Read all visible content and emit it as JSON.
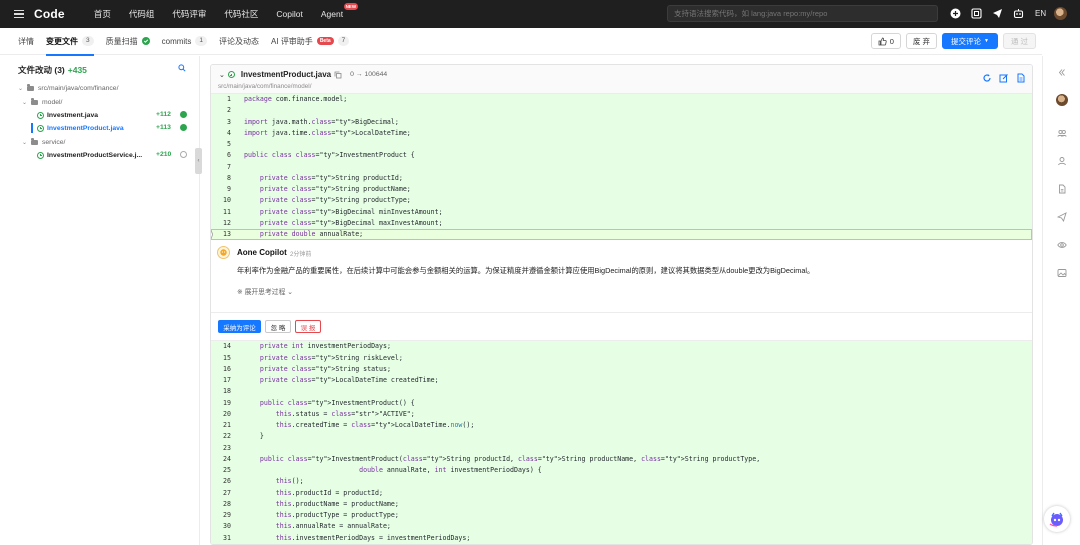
{
  "navbar": {
    "brand": "Code",
    "items": [
      {
        "label": "首页"
      },
      {
        "label": "代码组"
      },
      {
        "label": "代码评审"
      },
      {
        "label": "代码社区"
      },
      {
        "label": "Copilot"
      },
      {
        "label": "Agent",
        "badge": "NEW"
      }
    ],
    "search_placeholder": "支持语法搜索代码，如 lang:java repo:my/repo",
    "lang": "EN",
    "icons": [
      "plus-icon",
      "scan-icon",
      "send-icon",
      "bot-icon",
      "avatar"
    ]
  },
  "tabs": [
    {
      "label": "详情"
    },
    {
      "label": "变更文件",
      "count": "3",
      "active": true
    },
    {
      "label": "质量扫描",
      "check": true
    },
    {
      "label": "commits",
      "count": "1"
    },
    {
      "label": "评论及动态"
    },
    {
      "label": "AI 评审助手",
      "beta": "Beta",
      "count": "7"
    }
  ],
  "actions": {
    "like_count": "0",
    "abandon": "废 弃",
    "submit_review": "提交评论",
    "approve": "通 过"
  },
  "file_tree": {
    "header": "文件改动 (3)",
    "additions": "+435",
    "rows": [
      {
        "label": "src/main/java/com/finance/",
        "type": "folder",
        "depth": 0
      },
      {
        "label": "model/",
        "type": "folder",
        "depth": 1
      },
      {
        "label": "Investment.java",
        "type": "file",
        "depth": 2,
        "added": "+112",
        "status": "ok"
      },
      {
        "label": "InvestmentProduct.java",
        "type": "file",
        "depth": 2,
        "added": "+113",
        "status": "ok",
        "selected": true
      },
      {
        "label": "service/",
        "type": "folder",
        "depth": 1
      },
      {
        "label": "InvestmentProductService.j...",
        "type": "file",
        "depth": 2,
        "added": "+210",
        "status": "pending"
      }
    ]
  },
  "diff": {
    "file_name": "InvestmentProduct.java",
    "mode": "0 → 100644",
    "path": "src/main/java/com/finance/model/",
    "lines_top": [
      {
        "n": "1",
        "code": "package com.finance.model;"
      },
      {
        "n": "2",
        "code": ""
      },
      {
        "n": "3",
        "code": "import java.math.BigDecimal;"
      },
      {
        "n": "4",
        "code": "import java.time.LocalDateTime;"
      },
      {
        "n": "5",
        "code": ""
      },
      {
        "n": "6",
        "code": "public class InvestmentProduct {"
      },
      {
        "n": "7",
        "code": ""
      },
      {
        "n": "8",
        "code": "    private String productId;"
      },
      {
        "n": "9",
        "code": "    private String productName;"
      },
      {
        "n": "10",
        "code": "    private String productType;"
      },
      {
        "n": "11",
        "code": "    private BigDecimal minInvestAmount;"
      },
      {
        "n": "12",
        "code": "    private BigDecimal maxInvestAmount;"
      },
      {
        "n": "13",
        "code": "    private double annualRate;"
      }
    ],
    "lines_bottom": [
      {
        "n": "14",
        "code": "    private int investmentPeriodDays;"
      },
      {
        "n": "15",
        "code": "    private String riskLevel;"
      },
      {
        "n": "16",
        "code": "    private String status;"
      },
      {
        "n": "17",
        "code": "    private LocalDateTime createdTime;"
      },
      {
        "n": "18",
        "code": ""
      },
      {
        "n": "19",
        "code": "    public InvestmentProduct() {"
      },
      {
        "n": "20",
        "code": "        this.status = \"ACTIVE\";"
      },
      {
        "n": "21",
        "code": "        this.createdTime = LocalDateTime.now();"
      },
      {
        "n": "22",
        "code": "    }"
      },
      {
        "n": "23",
        "code": ""
      },
      {
        "n": "24",
        "code": "    public InvestmentProduct(String productId, String productName, String productType,"
      },
      {
        "n": "25",
        "code": "                             double annualRate, int investmentPeriodDays) {"
      },
      {
        "n": "26",
        "code": "        this();"
      },
      {
        "n": "27",
        "code": "        this.productId = productId;"
      },
      {
        "n": "28",
        "code": "        this.productName = productName;"
      },
      {
        "n": "29",
        "code": "        this.productType = productType;"
      },
      {
        "n": "30",
        "code": "        this.annualRate = annualRate;"
      },
      {
        "n": "31",
        "code": "        this.investmentPeriodDays = investmentPeriodDays;"
      }
    ]
  },
  "comment": {
    "author": "Aone Copilot",
    "time": "2分钟前",
    "text": "年利率作为金融产品的重要属性，在后续计算中可能会参与金额相关的运算。为保证精度并遵循金额计算应使用BigDecimal的原则，建议将其数据类型从double更改为BigDecimal。",
    "expand": "展开思考过程",
    "adopt": "采纳为评论",
    "ignore": "忽 略",
    "report": "误 报"
  },
  "colors": {
    "accent": "#1677ff",
    "added_bg": "#e6ffe4",
    "success": "#2da44e",
    "danger": "#e5484d"
  }
}
